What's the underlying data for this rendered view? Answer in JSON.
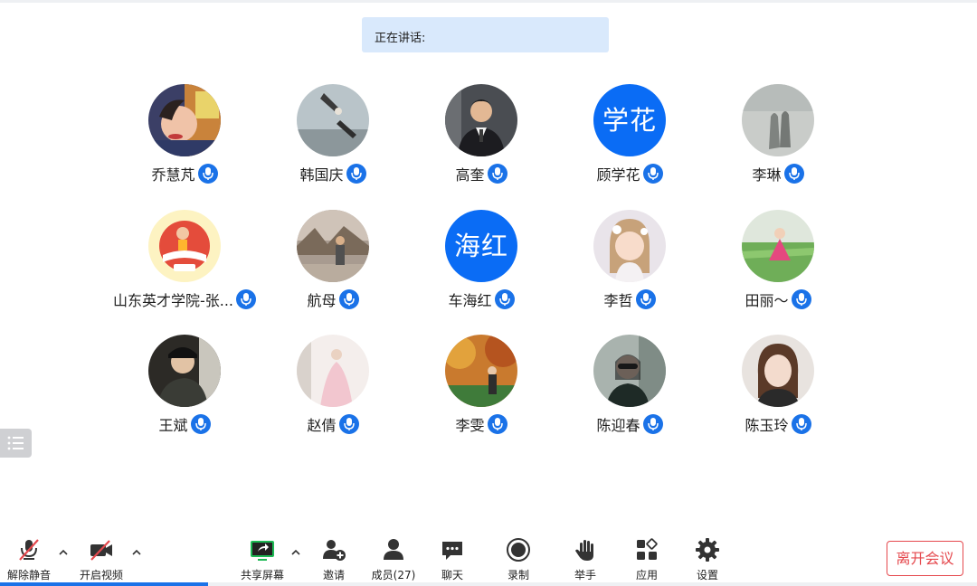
{
  "speaking": {
    "label": "正在讲话:"
  },
  "participants": [
    {
      "name": "乔慧芃",
      "avatar": "photo-girl-colorful"
    },
    {
      "name": "韩国庆",
      "avatar": "photo-hands-sky"
    },
    {
      "name": "高奎",
      "avatar": "photo-man-suit"
    },
    {
      "name": "顾学花",
      "avatar_text": "学花"
    },
    {
      "name": "李琳",
      "avatar": "photo-shadow-couple"
    },
    {
      "name": "山东英才学院-张...",
      "avatar": "illustration-book"
    },
    {
      "name": "航母",
      "avatar": "photo-person-outdoor"
    },
    {
      "name": "车海红",
      "avatar_text": "海红"
    },
    {
      "name": "李哲",
      "avatar": "photo-girl-flowers"
    },
    {
      "name": "田丽～",
      "avatar": "photo-girl-field"
    },
    {
      "name": "王斌",
      "avatar": "photo-man-car"
    },
    {
      "name": "赵倩",
      "avatar": "photo-bride"
    },
    {
      "name": "李雯",
      "avatar": "photo-autumn-park"
    },
    {
      "name": "陈迎春",
      "avatar": "photo-woman-sunglasses"
    },
    {
      "name": "陈玉玲",
      "avatar": "photo-woman-portrait"
    }
  ],
  "toolbar": {
    "unmute": "解除静音",
    "start_video": "开启视频",
    "share_screen": "共享屏幕",
    "invite": "邀请",
    "members": "成员(27)",
    "chat": "聊天",
    "record": "录制",
    "raise_hand": "举手",
    "apps": "应用",
    "settings": "设置",
    "leave": "离开会议"
  },
  "colors": {
    "accent": "#1a72e8",
    "leave": "#e5484d",
    "speaking_bg": "#d9e9fc"
  },
  "progress": {
    "fraction": 0.213
  }
}
